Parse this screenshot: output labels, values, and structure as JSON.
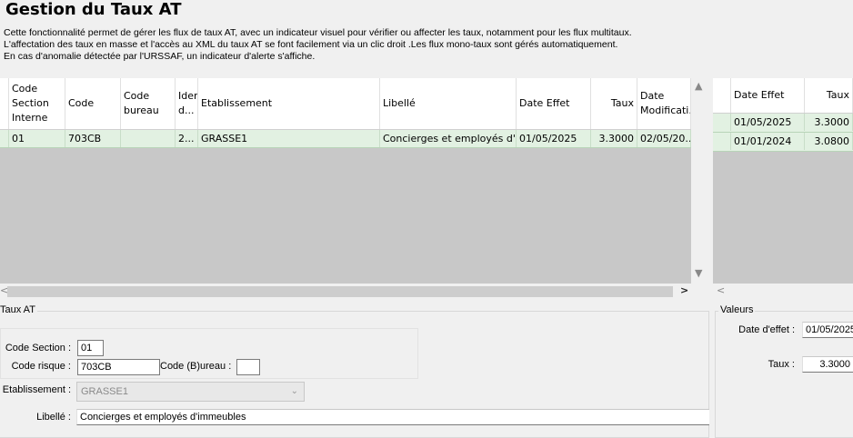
{
  "header": {
    "title": "Gestion du Taux AT",
    "desc_lines": [
      "Cette fonctionnalité permet de gérer les flux de taux AT, avec un indicateur visuel pour vérifier ou affecter les taux, notamment pour les flux multitaux.",
      "L'affectation des taux en masse et l'accès au XML du taux AT se font facilement via un clic droit .Les flux mono-taux sont gérés automatiquement.",
      "En cas d'anomalie détectée par l'URSSAF, un indicateur d'alerte s'affiche."
    ]
  },
  "main_grid": {
    "columns": [
      "Code Section Interne",
      "Code",
      "Code bureau",
      "Iden d...",
      "Etablissement",
      "Libellé",
      "Date Effet",
      "Taux",
      "Date Modificati..."
    ],
    "rows": [
      [
        "01",
        "703CB",
        "",
        "2...",
        "GRASSE1",
        "Concierges et employés d'...",
        "01/05/2025",
        "3.3000",
        "02/05/20..."
      ]
    ]
  },
  "right_grid": {
    "columns": [
      "Date Effet",
      "Taux"
    ],
    "rows": [
      [
        "01/05/2025",
        "3.3000"
      ],
      [
        "01/01/2024",
        "3.0800"
      ]
    ]
  },
  "taux_at": {
    "group_label": "Taux AT",
    "code_section_label": "Code Section :",
    "code_section_value": "01",
    "code_risque_label": "Code risque :",
    "code_risque_value": "703CB",
    "code_bureau_label": "Code (B)ureau :",
    "code_bureau_value": "",
    "etablissement_label": "Etablissement :",
    "etablissement_value": "GRASSE1",
    "libelle_label": "Libellé :",
    "libelle_value": "Concierges et employés d'immeubles"
  },
  "valeurs": {
    "group_label": "Valeurs",
    "date_effet_label": "Date d'effet :",
    "date_effet_value": "01/05/2025",
    "taux_label": "Taux :",
    "taux_value": "3.3000"
  },
  "icons": {
    "scroll_up": "▲",
    "scroll_down": "▼",
    "scroll_left": "<",
    "scroll_right": ">",
    "combo_arrow": "⌄"
  }
}
